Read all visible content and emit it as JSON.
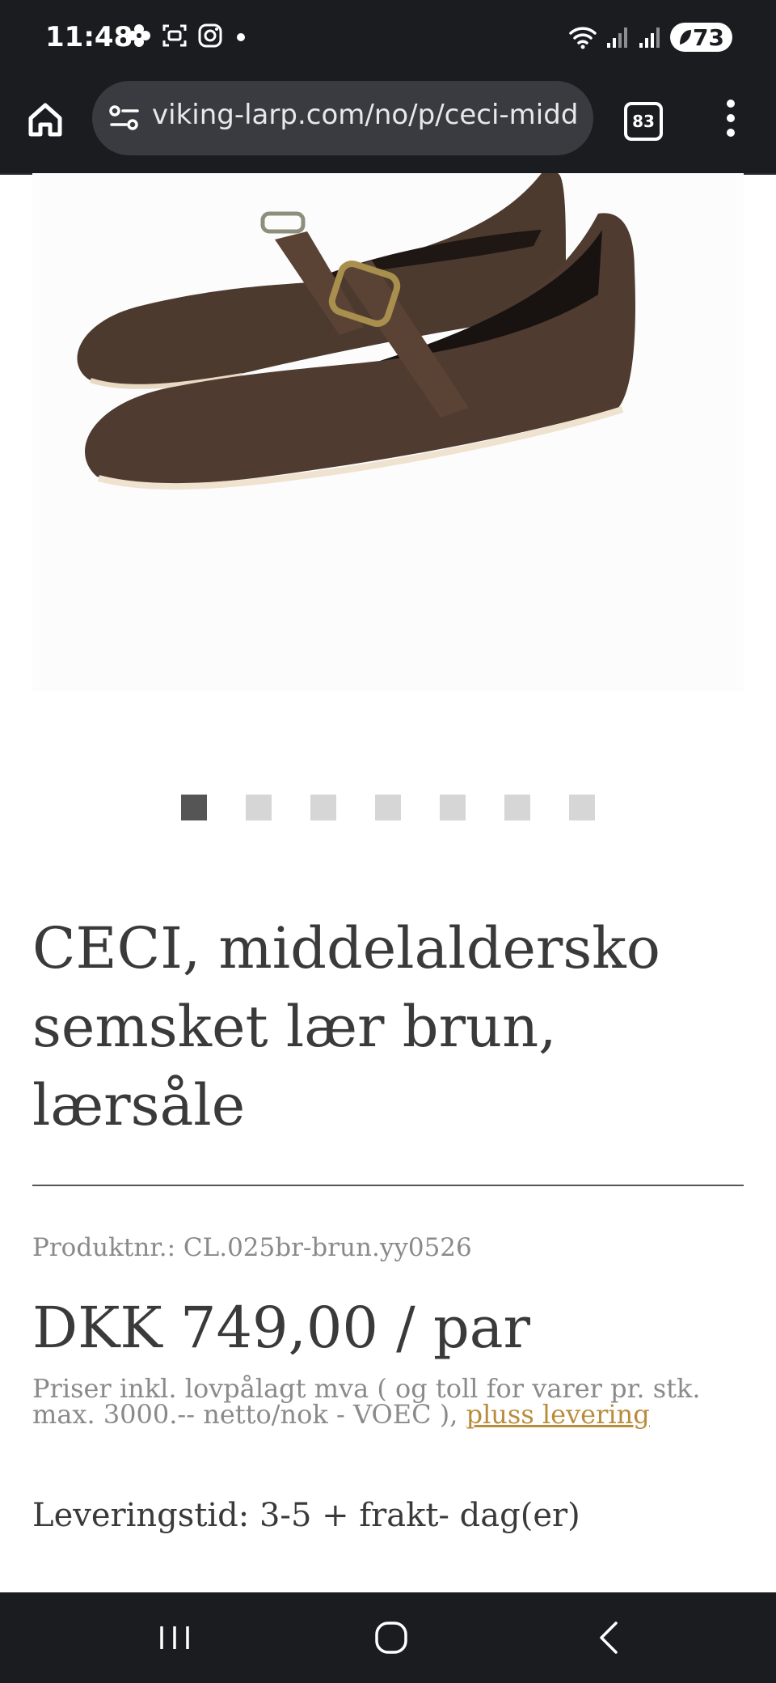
{
  "status_bar": {
    "time": "11:48",
    "battery": "73",
    "icons": [
      "pinwheel-icon",
      "screenshot-icon",
      "instagram-icon",
      "dot-icon",
      "wifi-icon",
      "signal-icon",
      "signal-icon"
    ]
  },
  "browser": {
    "url": "viking-larp.com/no/p/ceci-midd",
    "tab_count": "83"
  },
  "product": {
    "image_alt": "brown leather medieval shoes",
    "carousel": {
      "count": 7,
      "active_index": 0
    },
    "title": "CECI, middelaldersko semsket lær brun, lærsåle",
    "sku": "Produktnr.: CL.025br-brun.yy0526",
    "price": "DKK 749,00 / par",
    "tax_note": "Priser inkl. lovpålagt mva ( og toll for varer pr. stk. max. 3000.-- netto/nok - VOEC ), ",
    "shipping_link": "pluss levering",
    "delivery": "Leveringstid: 3-5 + frakt- dag(er)"
  },
  "colors": {
    "bar_bg": "#1b1c20",
    "link": "#b98c3c",
    "text": "#3a3a3a",
    "muted": "#8a8a8a"
  }
}
